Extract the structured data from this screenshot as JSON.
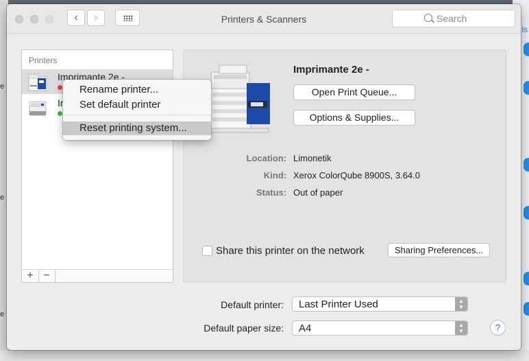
{
  "window": {
    "title": "Printers & Scanners"
  },
  "search": {
    "placeholder": "Search"
  },
  "printers": {
    "header": "Printers",
    "items": [
      {
        "name": "Imprimante 2e -",
        "status_color": "#e0443c",
        "selected": true
      },
      {
        "name": "Im",
        "status_color": "#3fbe3c",
        "selected": false
      }
    ],
    "add_label": "+",
    "remove_label": "−"
  },
  "context_menu": {
    "items": [
      {
        "label": "Rename printer..."
      },
      {
        "label": "Set default printer"
      },
      {
        "label": "Reset printing system..."
      }
    ]
  },
  "detail": {
    "printer_name": "Imprimante 2e -",
    "open_queue_label": "Open Print Queue...",
    "options_label": "Options & Supplies...",
    "info": [
      {
        "label": "Location:",
        "value": "Limonetik"
      },
      {
        "label": "Kind:",
        "value": "Xerox ColorQube 8900S, 3.64.0"
      },
      {
        "label": "Status:",
        "value": "Out of paper"
      }
    ],
    "share_label": "Share this printer on the network",
    "share_checked": false,
    "sharing_prefs_label": "Sharing Preferences..."
  },
  "defaults": {
    "printer_label": "Default printer:",
    "printer_value": "Last Printer Used",
    "paper_label": "Default paper size:",
    "paper_value": "A4"
  },
  "help": {
    "label": "?"
  },
  "background": {
    "left_texts": [
      "e",
      "e",
      "e"
    ],
    "right_text": "ls"
  },
  "colors": {
    "accent": "#2a7bd6",
    "printer_blue": "#1f4aa8"
  }
}
